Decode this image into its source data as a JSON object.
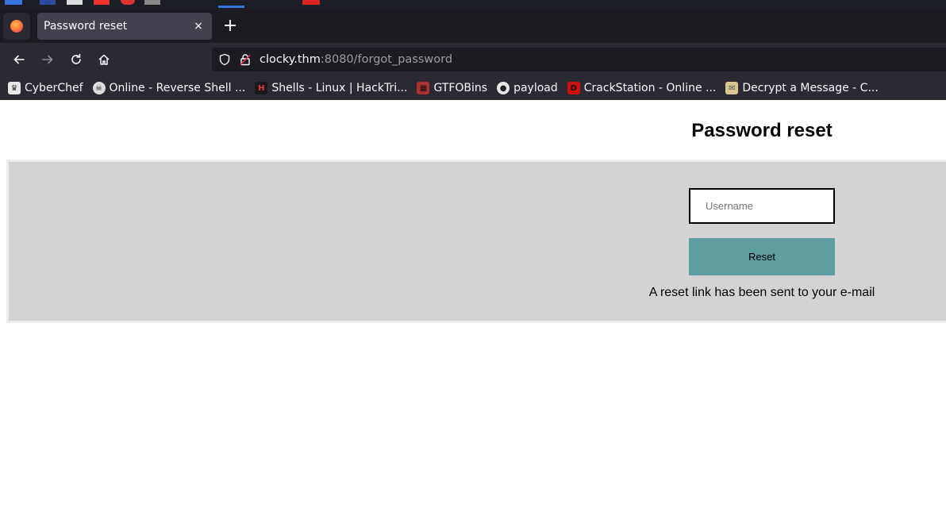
{
  "browser": {
    "tab_title": "Password reset",
    "new_tab_symbol": "+",
    "close_symbol": "×",
    "url_host": "clocky.thm",
    "url_rest": ":8080/forgot_password"
  },
  "bookmarks": [
    {
      "label": "CyberChef",
      "icon": "chef-hat-icon",
      "color": "#e8e8e8"
    },
    {
      "label": "Online - Reverse Shell ...",
      "icon": "skull-icon",
      "color": "#e8e8e8"
    },
    {
      "label": "Shells - Linux | HackTri...",
      "icon": "hacktricks-icon",
      "color": "#c0392b"
    },
    {
      "label": "GTFOBins",
      "icon": "gtfobins-icon",
      "color": "#b03030"
    },
    {
      "label": "payload",
      "icon": "github-icon",
      "color": "#e8e8e8"
    },
    {
      "label": "CrackStation - Online ...",
      "icon": "crackstation-icon",
      "color": "#d01010"
    },
    {
      "label": "Decrypt a Message - C...",
      "icon": "envelope-icon",
      "color": "#d8c890"
    }
  ],
  "page": {
    "title": "Password reset",
    "username_placeholder": "Username",
    "reset_label": "Reset",
    "message": "A reset link has been sent to your e-mail",
    "panel_color": "#d3d3d3",
    "button_color": "#5f9ea0"
  }
}
